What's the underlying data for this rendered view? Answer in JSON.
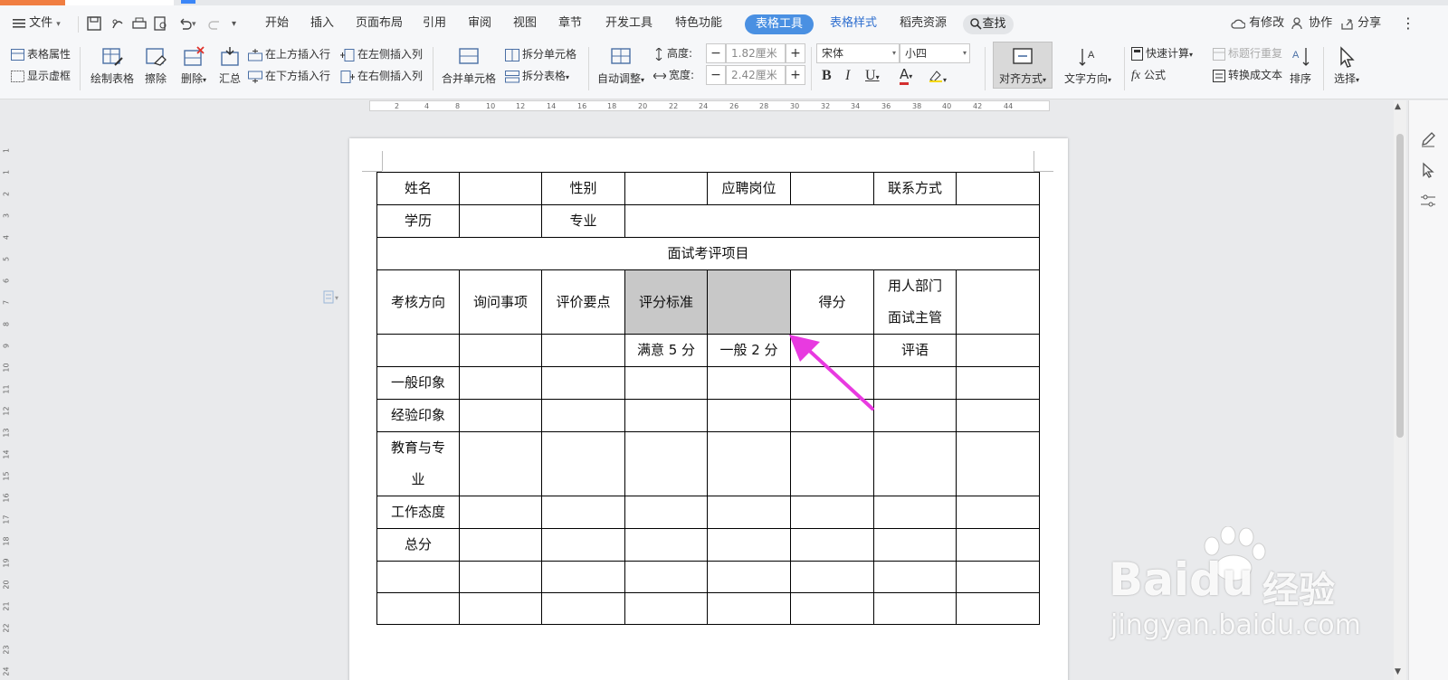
{
  "menubar": {
    "file_label": "文件",
    "tabs": [
      "开始",
      "插入",
      "页面布局",
      "引用",
      "审阅",
      "视图",
      "章节",
      "开发工具",
      "特色功能"
    ],
    "active_tab": "表格工具",
    "tab_table_style": "表格样式",
    "tab_resources": "稻壳资源",
    "search_label": "查找",
    "right_items": [
      "有修改",
      "协作",
      "分享"
    ]
  },
  "ribbon": {
    "table_props": "表格属性",
    "show_gridlines": "显示虚框",
    "draw_table": "绘制表格",
    "erase": "擦除",
    "delete": "删除",
    "summary": "汇总",
    "insert_row_above": "在上方插入行",
    "insert_row_below": "在下方插入行",
    "insert_col_left": "在左侧插入列",
    "insert_col_right": "在右侧插入列",
    "merge_cells": "合并单元格",
    "split_cells": "拆分单元格",
    "split_table": "拆分表格",
    "auto_fit": "自动调整",
    "height_label": "高度:",
    "height_value": "1.82厘米",
    "width_label": "宽度:",
    "width_value": "2.42厘米",
    "font_name": "宋体",
    "font_size": "小四",
    "align": "对齐方式",
    "text_direction": "文字方向",
    "quick_calc": "快速计算",
    "repeat_header": "标题行重复",
    "formula": "公式",
    "convert_to_text": "转换成文本",
    "sort": "排序",
    "select": "选择"
  },
  "ruler": {
    "h_labels": [
      "2",
      "4",
      "8",
      "10",
      "12",
      "14",
      "16",
      "18",
      "20",
      "22",
      "24",
      "26",
      "28",
      "30",
      "32",
      "34",
      "36",
      "38",
      "40",
      "42",
      "44"
    ],
    "v_labels": [
      "1",
      "1",
      "2",
      "3",
      "4",
      "5",
      "6",
      "7",
      "8",
      "9",
      "10",
      "11",
      "12",
      "13",
      "14",
      "15",
      "16",
      "17",
      "18",
      "19",
      "20",
      "21",
      "22",
      "23",
      "24"
    ]
  },
  "table": {
    "r1": [
      "姓名",
      "",
      "性别",
      "",
      "应聘岗位",
      "",
      "联系方式",
      ""
    ],
    "r2": [
      "学历",
      "",
      "专业",
      ""
    ],
    "r3": "面试考评项目",
    "r4": [
      "考核方向",
      "询问事项",
      "评价要点",
      "评分标准",
      "",
      "得分",
      "用人部门面试主管",
      ""
    ],
    "r4_dept_line1": "用人部门",
    "r4_dept_line2": "面试主管",
    "r5": [
      "",
      "",
      "",
      "满意 5 分",
      "一般 2 分",
      "",
      "评语",
      ""
    ],
    "rows": [
      [
        "一般印象",
        "",
        "",
        "",
        "",
        "",
        "",
        ""
      ],
      [
        "经验印象",
        "",
        "",
        "",
        "",
        "",
        "",
        ""
      ],
      [
        "教育与专业",
        "",
        "",
        "",
        "",
        "",
        "",
        ""
      ],
      [
        "工作态度",
        "",
        "",
        "",
        "",
        "",
        "",
        ""
      ],
      [
        "总分",
        "",
        "",
        "",
        "",
        "",
        "",
        ""
      ],
      [
        "",
        "",
        "",
        "",
        "",
        "",
        "",
        ""
      ],
      [
        "",
        "",
        "",
        "",
        "",
        "",
        "",
        ""
      ]
    ],
    "edu_line1": "教育与专",
    "edu_line2": "业"
  },
  "annotation_color": "#e83ae0",
  "watermark": {
    "brand": "Bai",
    "brand2": "du",
    "cn": "经验",
    "url": "jingyan.baidu.com"
  }
}
